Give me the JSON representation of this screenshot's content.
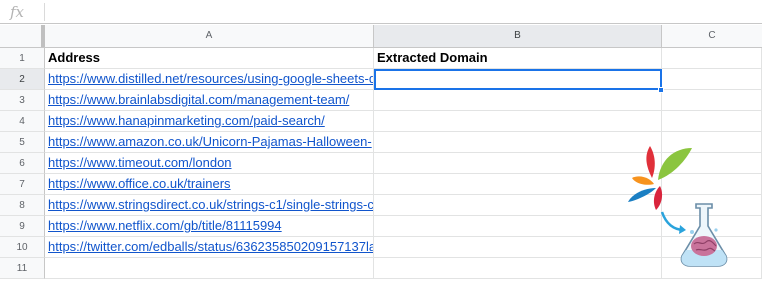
{
  "formula_bar": {
    "fx_label": "fx",
    "value": ""
  },
  "columns": [
    "A",
    "B",
    "C"
  ],
  "rows": [
    {
      "num": "1",
      "a": "Address",
      "b": "Extracted Domain",
      "c": ""
    },
    {
      "num": "2",
      "a": "https://www.distilled.net/resources/using-google-sheets-d",
      "b": "",
      "c": ""
    },
    {
      "num": "3",
      "a": "https://www.brainlabsdigital.com/management-team/",
      "b": "",
      "c": ""
    },
    {
      "num": "4",
      "a": "https://www.hanapinmarketing.com/paid-search/",
      "b": "",
      "c": ""
    },
    {
      "num": "5",
      "a": "https://www.amazon.co.uk/Unicorn-Pajamas-Halloween-",
      "b": "",
      "c": ""
    },
    {
      "num": "6",
      "a": "https://www.timeout.com/london",
      "b": "",
      "c": ""
    },
    {
      "num": "7",
      "a": "https://www.office.co.uk/trainers",
      "b": "",
      "c": ""
    },
    {
      "num": "8",
      "a": "https://www.stringsdirect.co.uk/strings-c1/single-strings-c",
      "b": "",
      "c": ""
    },
    {
      "num": "9",
      "a": "https://www.netflix.com/gb/title/81115994",
      "b": "",
      "c": ""
    },
    {
      "num": "10",
      "a": "https://twitter.com/edballs/status/636235850209157137la",
      "b": "",
      "c": ""
    },
    {
      "num": "11",
      "a": "",
      "b": "",
      "c": ""
    }
  ],
  "active_cell": {
    "column": "B",
    "row": "2"
  },
  "colors": {
    "link": "#1155cc",
    "selection": "#1a73e8",
    "header_bg": "#f8f9fa"
  },
  "logo": {
    "icon": "flask-brain-logo"
  }
}
